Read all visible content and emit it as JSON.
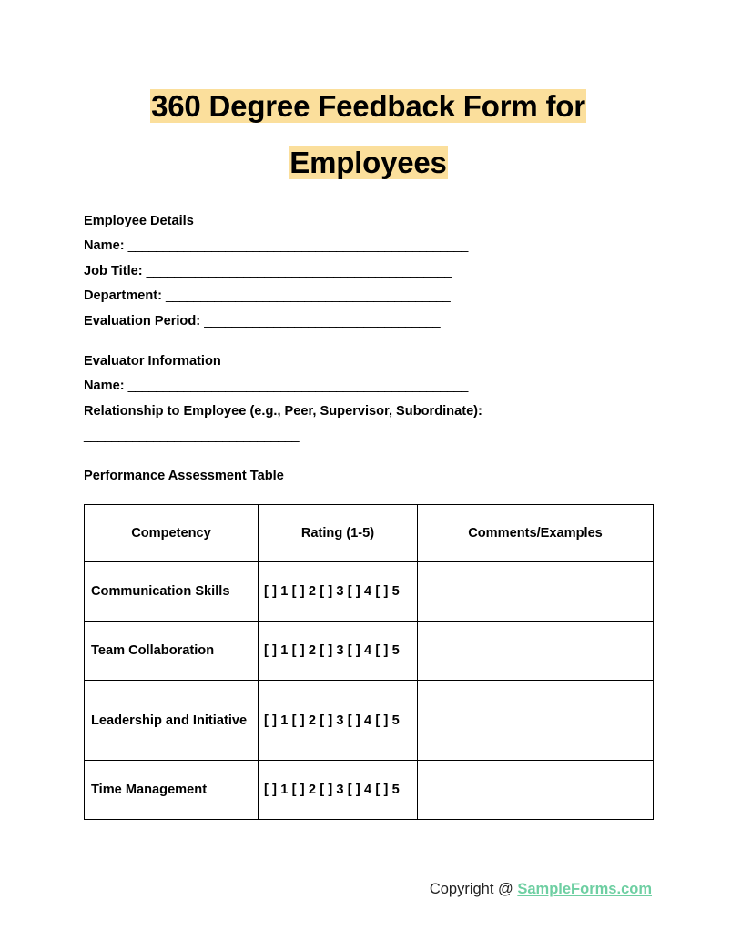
{
  "document": {
    "title_line_1": "360 Degree Feedback Form for",
    "title_line_2": "Employees",
    "highlight_color": "#fbdf9c"
  },
  "employee_details": {
    "heading": "Employee Details",
    "fields": [
      {
        "label": "Name:",
        "rule": "_________________________________________________"
      },
      {
        "label": "Job Title:",
        "rule": "____________________________________________"
      },
      {
        "label": "Department:",
        "rule": "_________________________________________"
      },
      {
        "label": "Evaluation Period:",
        "rule": "__________________________________"
      }
    ]
  },
  "evaluator_information": {
    "heading": "Evaluator Information",
    "name_label": "Name:",
    "name_rule": "_________________________________________________",
    "relationship_label": "Relationship to Employee (e.g., Peer, Supervisor, Subordinate):",
    "relationship_rule": "_______________________________"
  },
  "assessment": {
    "heading": "Performance Assessment Table",
    "columns": [
      "Competency",
      "Rating (1-5)",
      "Comments/Examples"
    ],
    "rating_scale": "[ ] 1 [ ] 2 [ ] 3 [ ] 4 [ ] 5",
    "rows": [
      {
        "competency": "Communication Skills",
        "rating": "[ ] 1 [ ] 2 [ ] 3 [ ] 4 [ ] 5",
        "comments": ""
      },
      {
        "competency": "Team Collaboration",
        "rating": "[ ] 1 [ ] 2 [ ] 3 [ ] 4 [ ] 5",
        "comments": ""
      },
      {
        "competency": "Leadership and Initiative",
        "rating": "[ ] 1 [ ] 2 [ ] 3 [ ] 4 [ ] 5",
        "comments": ""
      },
      {
        "competency": "Time Management",
        "rating": "[ ] 1 [ ] 2 [ ] 3 [ ] 4 [ ] 5",
        "comments": ""
      }
    ]
  },
  "footer": {
    "copyright_text": "Copyright @ ",
    "site_name": "SampleForms.com",
    "link_color": "#6ecfa2"
  }
}
